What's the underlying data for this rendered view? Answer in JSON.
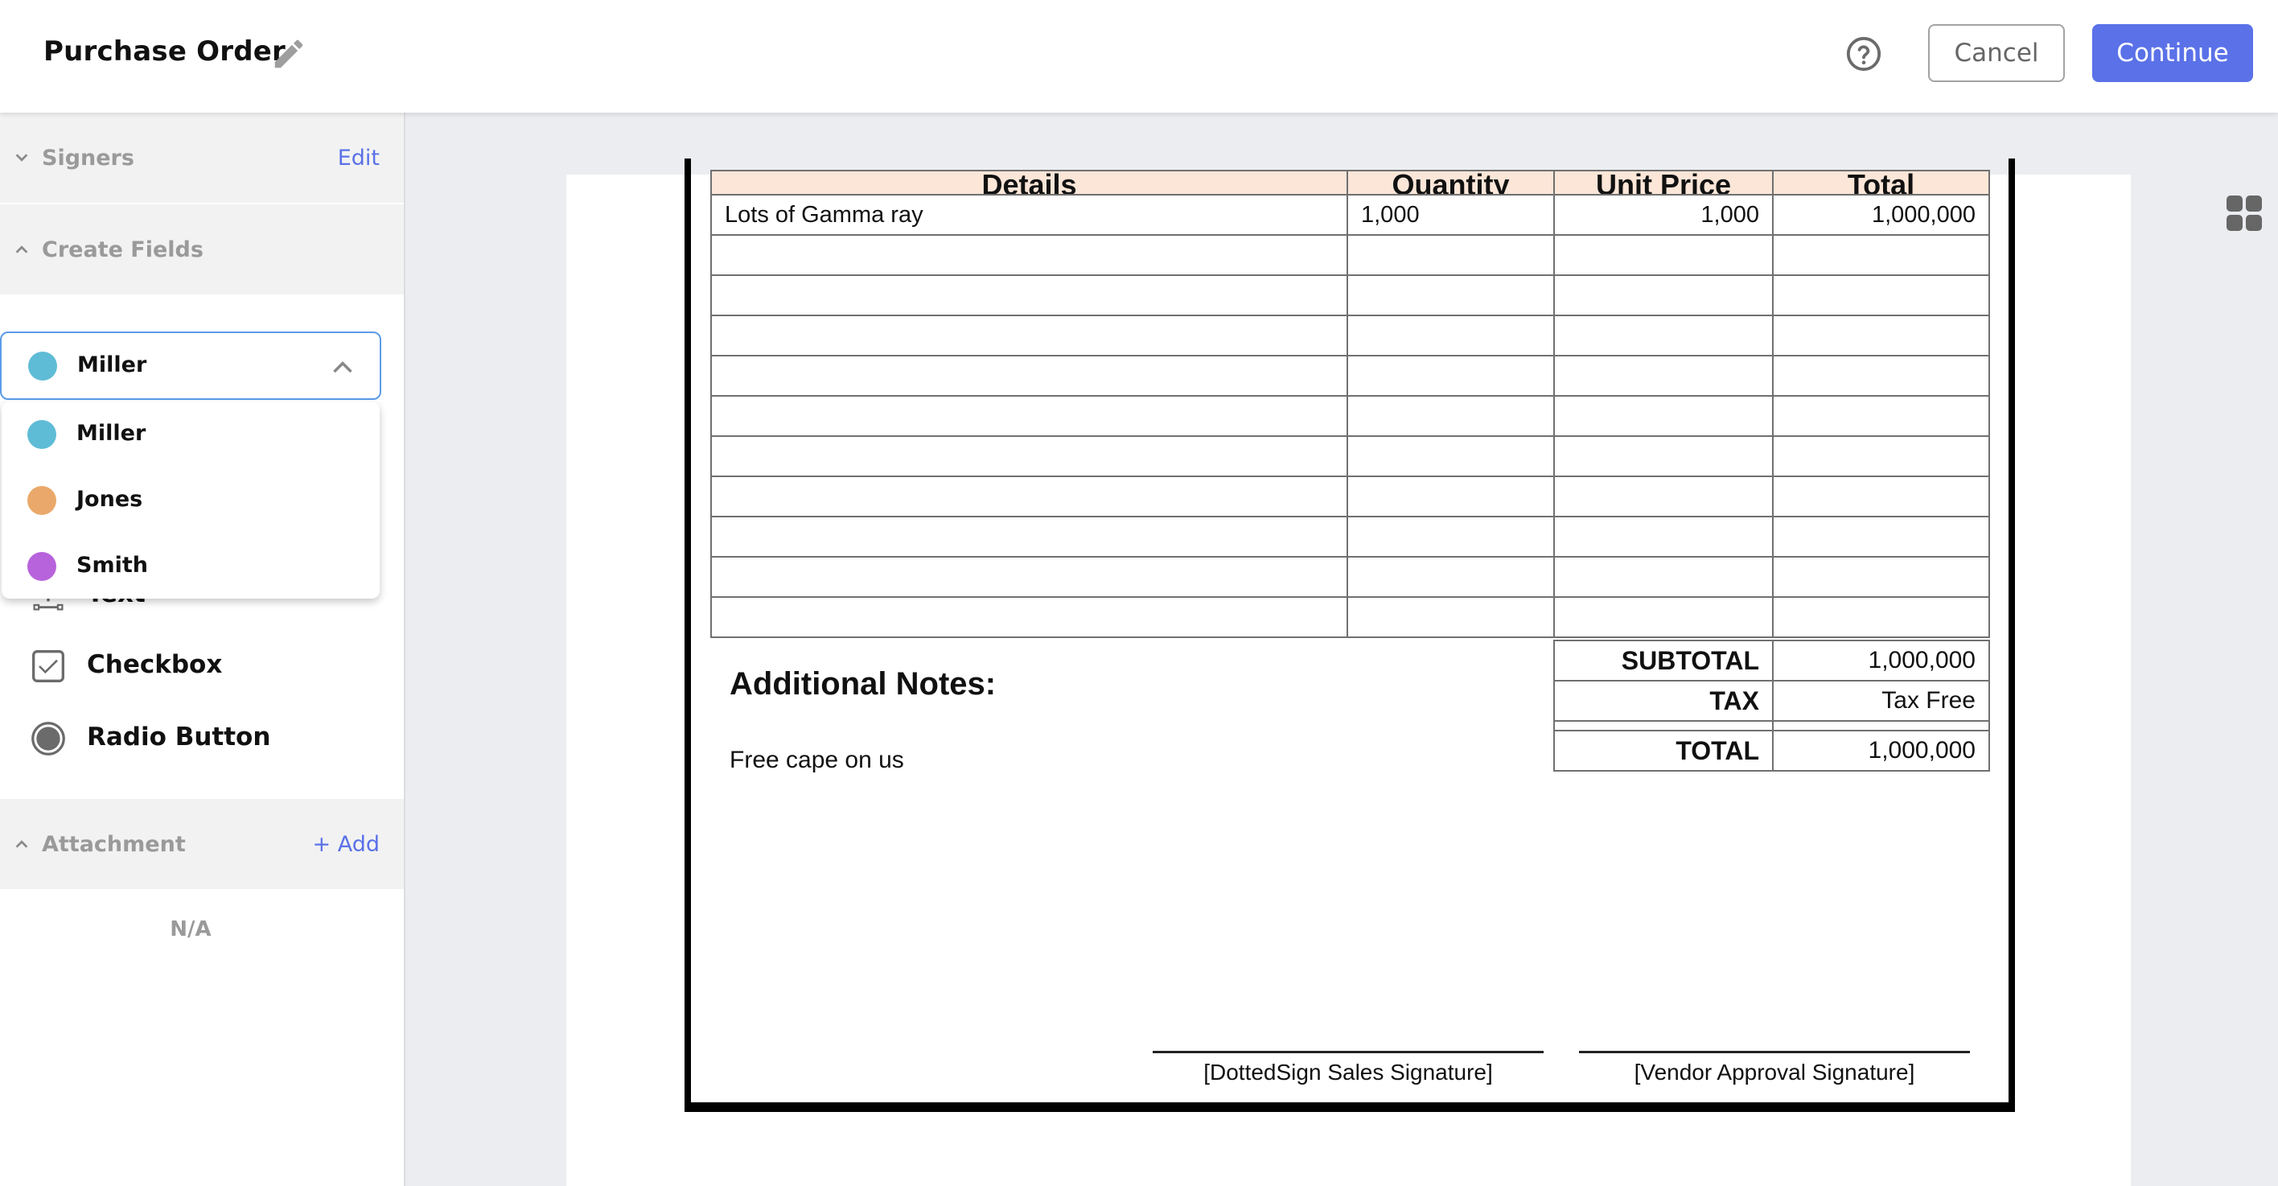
{
  "header": {
    "title": "Purchase Order",
    "edit_icon": "pencil-icon",
    "help_icon": "question-circle-icon",
    "cancel_label": "Cancel",
    "continue_label": "Continue",
    "accent_color": "#5a71e8"
  },
  "sidebar": {
    "signers": {
      "label": "Signers",
      "action": "Edit",
      "expanded": false
    },
    "create_fields": {
      "label": "Create Fields",
      "expanded": true,
      "signer_select": {
        "selected": "Miller",
        "selected_color": "#5fbcd6",
        "open": true,
        "options": [
          {
            "name": "Miller",
            "color": "#5fbcd6"
          },
          {
            "name": "Jones",
            "color": "#eaa96a"
          },
          {
            "name": "Smith",
            "color": "#b763dc"
          }
        ]
      },
      "fields": [
        {
          "label": "Text",
          "icon": "text-field-icon"
        },
        {
          "label": "Checkbox",
          "icon": "checkbox-icon"
        },
        {
          "label": "Radio Button",
          "icon": "radio-button-icon"
        }
      ]
    },
    "attachment": {
      "label": "Attachment",
      "action": "+ Add",
      "empty_text": "N/A"
    }
  },
  "document": {
    "table": {
      "headers": [
        "Details",
        "Quantity",
        "Unit Price",
        "Total"
      ],
      "rows": [
        [
          "Lots of Gamma ray",
          "1,000",
          "1,000",
          "1,000,000"
        ],
        [
          "",
          "",
          "",
          ""
        ],
        [
          "",
          "",
          "",
          ""
        ],
        [
          "",
          "",
          "",
          ""
        ],
        [
          "",
          "",
          "",
          ""
        ],
        [
          "",
          "",
          "",
          ""
        ],
        [
          "",
          "",
          "",
          ""
        ],
        [
          "",
          "",
          "",
          ""
        ],
        [
          "",
          "",
          "",
          ""
        ],
        [
          "",
          "",
          "",
          ""
        ],
        [
          "",
          "",
          "",
          ""
        ]
      ]
    },
    "summary": {
      "subtotal_label": "SUBTOTAL",
      "subtotal_value": "1,000,000",
      "tax_label": "TAX",
      "tax_value": "Tax Free",
      "total_label": "TOTAL",
      "total_value": "1,000,000"
    },
    "notes_heading": "Additional Notes:",
    "notes_text": "Free cape on us",
    "signature_1": "[DottedSign Sales Signature]",
    "signature_2": "[Vendor Approval Signature]"
  },
  "toolbar": {
    "thumbnail_icon": "grid-view-icon"
  }
}
